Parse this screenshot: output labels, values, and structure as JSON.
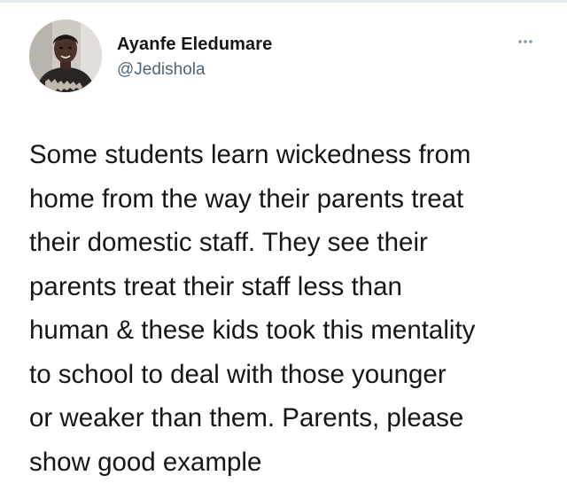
{
  "tweet": {
    "author": {
      "display_name": "Ayanfe Eledumare",
      "handle": "@Jedishola",
      "avatar_icon": "profile-photo"
    },
    "more_icon": "ellipsis-icon",
    "text": "Some students learn wickedness from\nhome from the way their parents treat\ntheir domestic staff. They see their\nparents treat their staff less than\nhuman & these kids took this mentality\nto school to deal with those younger\nor weaker than them. Parents, please\nshow good example"
  },
  "colors": {
    "text_primary": "#14171a",
    "text_secondary": "#536471",
    "icon_muted": "#8899a6",
    "divider": "#e6ecf0"
  }
}
